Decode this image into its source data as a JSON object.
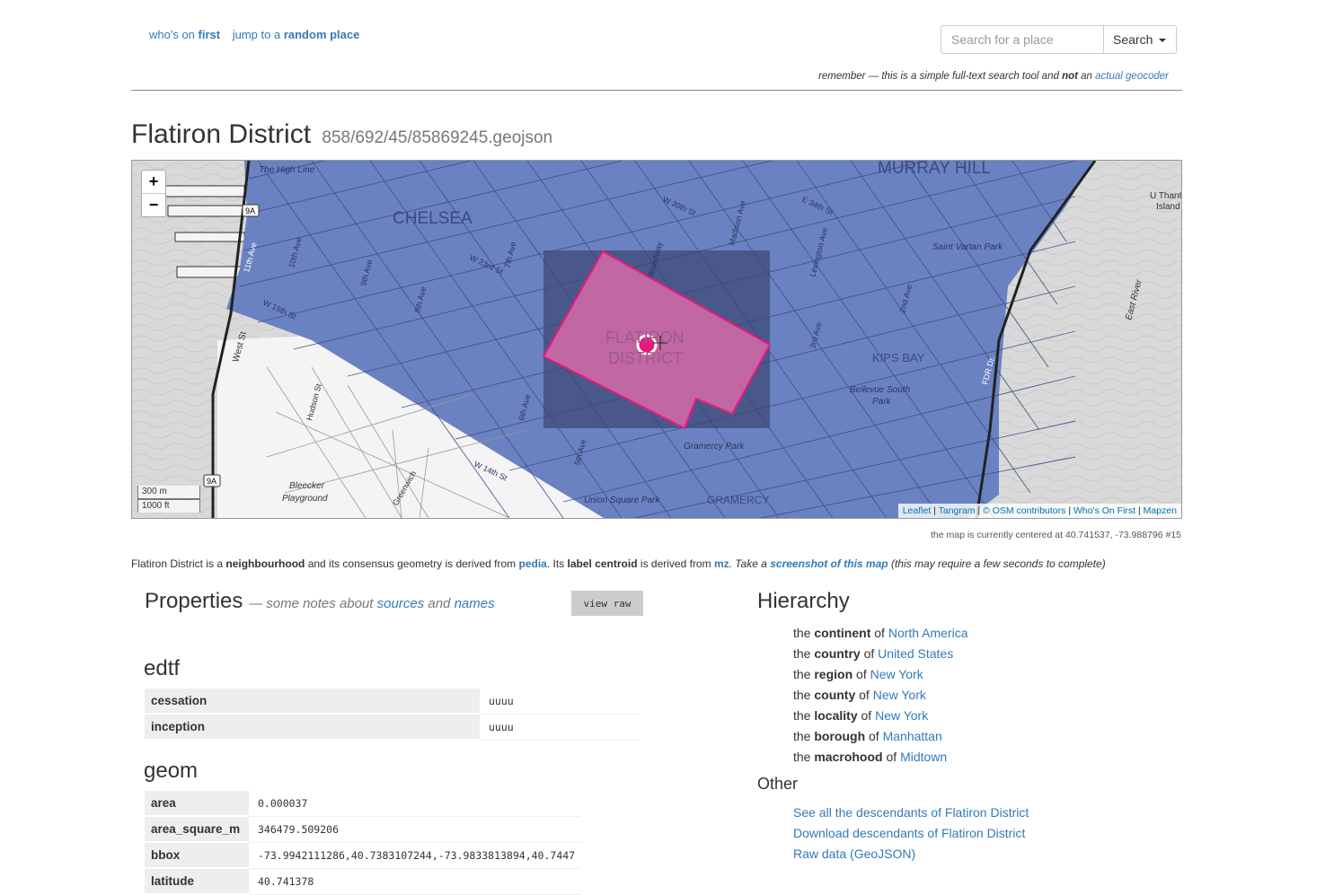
{
  "nav": {
    "whos_on_prefix": "who's on",
    "whos_on_link": "first",
    "jump_prefix": "jump to a",
    "jump_link": "random place"
  },
  "search": {
    "placeholder": "Search for a place",
    "button_label": "Search"
  },
  "remember": {
    "prefix": "remember — this is a simple full-text search tool and",
    "bold": "not",
    "an": "an",
    "link": "actual geocoder"
  },
  "page": {
    "title": "Flatiron District",
    "file": "858/692/45/85869245.geojson"
  },
  "map": {
    "zoom_in": "+",
    "zoom_out": "−",
    "scale_metric": "300 m",
    "scale_imperial": "1000 ft",
    "attribution": [
      "Leaflet",
      "Tangram",
      "© OSM contributors",
      "Who's On First",
      "Mapzen"
    ],
    "labels": {
      "chelsea": "CHELSEA",
      "murray_hill": "MURRAY HILL",
      "flatiron": "FLATIRON",
      "district": "DISTRICT",
      "kips_bay": "KIPS BAY",
      "gramercy": "GRAMERCY",
      "high_line": "The High Line",
      "gramercy_park": "Gramercy Park",
      "union_square_park": "Union Square Park",
      "bellevue_south": "Bellevue South",
      "park": "Park",
      "saint_vartan_park": "Saint Vartan Park",
      "bleecker": "Bleecker",
      "playground": "Playground",
      "east_river": "East River",
      "u_thant": "U Thant",
      "island": "Island",
      "west_st": "West St",
      "broadway": "Broadway",
      "fdr_dr": "FDR Dr.",
      "route_9a": "9A",
      "w23": "W 23rd St",
      "w15": "W 15th St",
      "w14": "W 14th St",
      "ave5": "5th Ave",
      "ave6": "6th Ave",
      "ave7": "7th Ave",
      "ave8": "8th Ave",
      "ave9": "9th Ave",
      "ave10": "10th Ave",
      "ave11": "11th Ave",
      "madison": "Madison Ave",
      "lexington": "Lexington Ave",
      "ave2": "2nd Ave",
      "ave3": "3rd Ave",
      "e34": "E 34th St",
      "w30": "W 30th St",
      "hudson": "Hudson St",
      "greenwich": "Greenwich"
    },
    "colors": {
      "neighbourhood_fill": "#6b82c2",
      "bbox_fill": "#3b4670",
      "geometry_fill": "#d66aa8",
      "geometry_stroke": "#e8197d",
      "water": "#d9d9d9",
      "land": "#f2f2f2"
    }
  },
  "center_note": "the map is currently centered at 40.741537, -73.988796 #15",
  "description": {
    "p1": "Flatiron District is a",
    "placetype": "neighbourhood",
    "p2": "and its consensus geometry is derived from",
    "geom_src": "pedia",
    "p3": ". Its",
    "label_centroid": "label centroid",
    "p4": "is derived from",
    "centroid_src": "mz",
    "p5": ". Take a",
    "screenshot_link": "screenshot of this map",
    "p6": "(this may require a few seconds to complete)"
  },
  "properties": {
    "title": "Properties",
    "notes_prefix": "— some notes about",
    "sources_link": "sources",
    "and": "and",
    "names_link": "names",
    "view_raw": "view raw",
    "sections": [
      {
        "name": "edtf",
        "rows": [
          {
            "key": "cessation",
            "value": "uuuu"
          },
          {
            "key": "inception",
            "value": "uuuu"
          }
        ]
      },
      {
        "name": "geom",
        "rows": [
          {
            "key": "area",
            "value": "0.000037"
          },
          {
            "key": "area_square_m",
            "value": "346479.509206"
          },
          {
            "key": "bbox",
            "value": "-73.9942111286,40.7383107244,-73.9833813894,40.7447"
          },
          {
            "key": "latitude",
            "value": "40.741378"
          }
        ]
      }
    ]
  },
  "hierarchy": {
    "title": "Hierarchy",
    "items": [
      {
        "the": "the",
        "type": "continent",
        "of": "of",
        "name": "North America"
      },
      {
        "the": "the",
        "type": "country",
        "of": "of",
        "name": "United States"
      },
      {
        "the": "the",
        "type": "region",
        "of": "of",
        "name": "New York"
      },
      {
        "the": "the",
        "type": "county",
        "of": "of",
        "name": "New York"
      },
      {
        "the": "the",
        "type": "locality",
        "of": "of",
        "name": "New York"
      },
      {
        "the": "the",
        "type": "borough",
        "of": "of",
        "name": "Manhattan"
      },
      {
        "the": "the",
        "type": "macrohood",
        "of": "of",
        "name": "Midtown"
      }
    ]
  },
  "other": {
    "title": "Other",
    "links": [
      "See all the descendants of Flatiron District",
      "Download descendants of Flatiron District",
      "Raw data (GeoJSON)"
    ]
  }
}
